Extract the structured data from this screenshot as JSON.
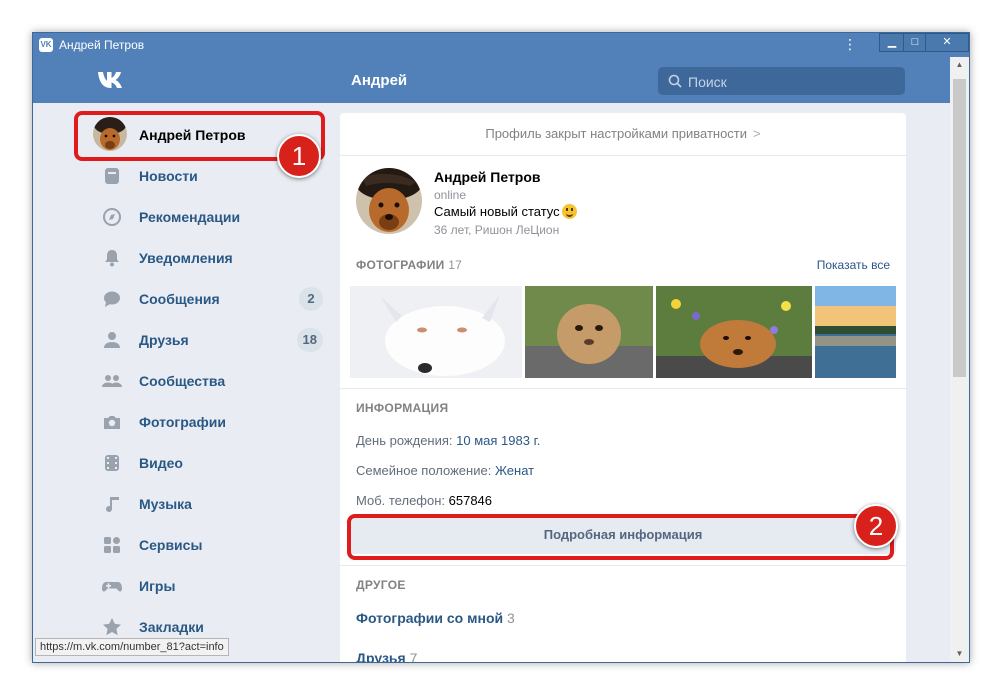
{
  "window": {
    "title": "Андрей Петров",
    "app_icon": "vk-icon"
  },
  "header": {
    "logo": "VK",
    "title": "Андрей",
    "search_placeholder": "Поиск"
  },
  "sidebar": {
    "profile_name": "Андрей Петров",
    "items": [
      {
        "label": "Новости",
        "icon": "news-icon"
      },
      {
        "label": "Рекомендации",
        "icon": "compass-icon"
      },
      {
        "label": "Уведомления",
        "icon": "bell-icon"
      },
      {
        "label": "Сообщения",
        "icon": "chat-icon",
        "badge": "2"
      },
      {
        "label": "Друзья",
        "icon": "person-icon",
        "badge": "18"
      },
      {
        "label": "Сообщества",
        "icon": "group-icon"
      },
      {
        "label": "Фотографии",
        "icon": "camera-icon"
      },
      {
        "label": "Видео",
        "icon": "video-icon"
      },
      {
        "label": "Музыка",
        "icon": "music-icon"
      },
      {
        "label": "Сервисы",
        "icon": "services-icon"
      },
      {
        "label": "Игры",
        "icon": "gamepad-icon"
      },
      {
        "label": "Закладки",
        "icon": "star-icon"
      }
    ]
  },
  "status_url": "https://m.vk.com/number_81?act=info",
  "main": {
    "privacy_notice": "Профиль закрыт настройками приватности",
    "privacy_chevron": ">",
    "profile": {
      "name": "Андрей Петров",
      "online": "online",
      "status": "Самый новый статус",
      "details": "36 лет, Ришон ЛеЦион"
    },
    "photos": {
      "heading": "ФОТОГРАФИИ",
      "count": "17",
      "show_all": "Показать все"
    },
    "info": {
      "heading": "ИНФОРМАЦИЯ",
      "birthday_label": "День рождения:",
      "birthday_value": "10 мая 1983 г.",
      "family_label": "Семейное положение:",
      "family_value": "Женат",
      "phone_label": "Моб. телефон:",
      "phone_value": "657846",
      "detail_button": "Подробная информация"
    },
    "other": {
      "heading": "ДРУГОЕ",
      "photos_with_me": "Фотографии со мной",
      "photos_with_me_count": "3",
      "friends": "Друзья",
      "friends_count": "7"
    }
  },
  "annotations": {
    "marker1": "1",
    "marker2": "2"
  },
  "colors": {
    "vk_blue": "#5181b8",
    "link": "#2a5885",
    "highlight": "#e01b1b",
    "background": "#e9edf3"
  }
}
